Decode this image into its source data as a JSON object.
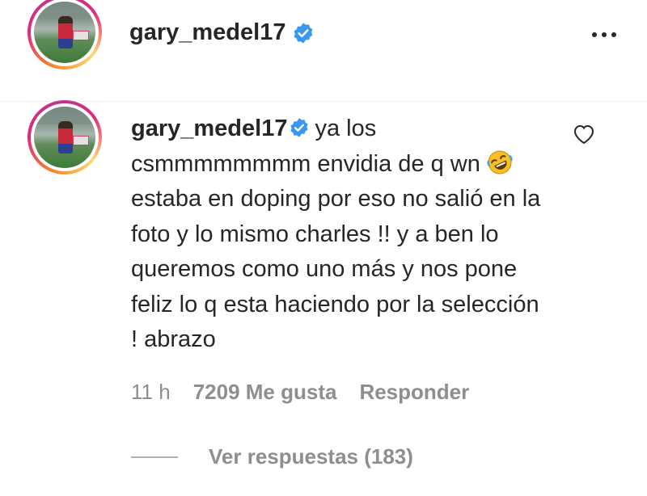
{
  "post_header": {
    "username": "gary_medel17",
    "verified": true,
    "more_icon": "more-horizontal-icon"
  },
  "comment": {
    "username": "gary_medel17",
    "verified": true,
    "text_parts": {
      "part1": "ya los csmmmmmmmm envidia de q wn",
      "emoji": "rolling-on-floor-laughing-emoji",
      "part2": "estaba en doping por eso no salió en la foto y lo mismo charles !! y a ben lo queremos como uno más y nos pone feliz lo q esta haciendo por la selección ! abrazo"
    },
    "time": "11 h",
    "likes": "7209 Me gusta",
    "reply_label": "Responder",
    "view_replies": "Ver respuestas (183)"
  },
  "colors": {
    "text": "#262626",
    "secondary": "#8e8e8e",
    "verified_blue": "#3897f0"
  }
}
